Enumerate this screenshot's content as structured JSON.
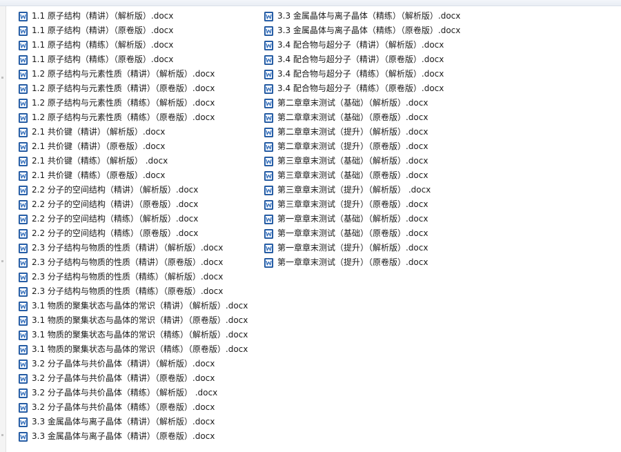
{
  "file_icon": "word-document-icon",
  "files": [
    "1.1 原子结构（精讲）（解析版）.docx",
    "1.1 原子结构（精讲）（原卷版）.docx",
    "1.1 原子结构（精练）（解析版）.docx",
    "1.1 原子结构（精练）（原卷版）.docx",
    "1.2 原子结构与元素性质（精讲）（解析版）.docx",
    "1.2 原子结构与元素性质（精讲）（原卷版）.docx",
    "1.2 原子结构与元素性质（精练）（解析版）.docx",
    "1.2 原子结构与元素性质（精练）（原卷版）.docx",
    "2.1 共价键（精讲）（解析版）.docx",
    "2.1 共价键（精讲）（原卷版）.docx",
    "2.1 共价键（精练）（解析版） .docx",
    "2.1 共价键（精练）（原卷版）.docx",
    "2.2 分子的空间结构（精讲）（解析版）.docx",
    "2.2 分子的空间结构（精讲）（原卷版）.docx",
    "2.2 分子的空间结构（精练）（解析版）.docx",
    "2.2 分子的空间结构（精练）（原卷版）.docx",
    "2.3 分子结构与物质的性质（精讲）（解析版）.docx",
    "2.3 分子结构与物质的性质（精讲）（原卷版）.docx",
    "2.3 分子结构与物质的性质（精练）（解析版）.docx",
    "2.3 分子结构与物质的性质（精练）（原卷版）.docx",
    "3.1 物质的聚集状态与晶体的常识（精讲）（解析版）.docx",
    "3.1 物质的聚集状态与晶体的常识（精讲）（原卷版）.docx",
    "3.1 物质的聚集状态与晶体的常识（精练）（解析版）.docx",
    "3.1 物质的聚集状态与晶体的常识（精练）（原卷版）.docx",
    "3.2 分子晶体与共价晶体（精讲）（解析版）.docx",
    "3.2 分子晶体与共价晶体（精讲）（原卷版）.docx",
    "3.2 分子晶体与共价晶体（精练）（解析版） .docx",
    "3.2 分子晶体与共价晶体（精练）（原卷版）.docx",
    "3.3 金属晶体与离子晶体（精讲）（解析版）.docx",
    "3.3 金属晶体与离子晶体（精讲）（原卷版）.docx",
    "3.3 金属晶体与离子晶体（精练）（解析版）.docx",
    "3.3 金属晶体与离子晶体（精练）（原卷版）.docx",
    "3.4 配合物与超分子（精讲）（解析版）.docx",
    "3.4 配合物与超分子（精讲）（原卷版）.docx",
    "3.4 配合物与超分子（精练）（解析版）.docx",
    "3.4 配合物与超分子（精练）（原卷版）.docx",
    "第二章章末测试（基础）（解析版）.docx",
    "第二章章末测试（基础）（原卷版）.docx",
    "第二章章末测试（提升）（解析版）.docx",
    "第二章章末测试（提升）（原卷版）.docx",
    "第三章章末测试（基础）（解析版）.docx",
    "第三章章末测试（基础）（原卷版）.docx",
    "第三章章末测试（提升）（解析版） .docx",
    "第三章章末测试（提升）（原卷版）.docx",
    "第一章章末测试（基础）（解析版）.docx",
    "第一章章末测试（基础）（原卷版）.docx",
    "第一章章末测试（提升）（解析版）.docx",
    "第一章章末测试（提升）（原卷版）.docx"
  ]
}
